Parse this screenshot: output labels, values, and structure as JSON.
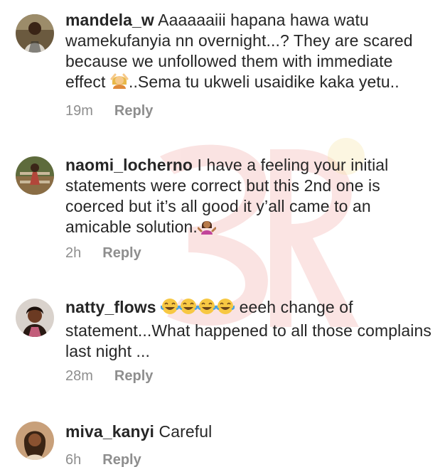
{
  "comments": [
    {
      "username": "mandela_w",
      "text_before_emoji": "Aaaaaaiii hapana hawa watu wamekufanyia nn overnight...? They are scared because we unfollowed them with immediate effect",
      "emoji": "woman-gesturing-ok-icon",
      "text_after_emoji": "..Sema tu ukweli usaidike kaka yetu..",
      "time": "19m",
      "reply_label": "Reply"
    },
    {
      "username": "naomi_locherno",
      "text_before_emoji": "I have a feeling your initial statements were correct but this 2nd one is coerced but it’s all good it y’all came to an amicable solution.",
      "emoji": "woman-shrugging-icon",
      "text_after_emoji": "",
      "time": "2h",
      "reply_label": "Reply"
    },
    {
      "username": "natty_flows",
      "text_before_emoji": "",
      "emoji": "face-with-tears-of-joy-icon",
      "emoji_count": 4,
      "text_after_emoji": "eeeh change of statement...What happened to all those complains last night ...",
      "time": "28m",
      "reply_label": "Reply"
    },
    {
      "username": "miva_kanyi",
      "text_before_emoji": "Careful",
      "emoji": "",
      "text_after_emoji": "",
      "time": "6h",
      "reply_label": "Reply"
    }
  ],
  "colors": {
    "text": "#262626",
    "meta": "#8e8e8e",
    "watermark": "#e8a0a0"
  }
}
